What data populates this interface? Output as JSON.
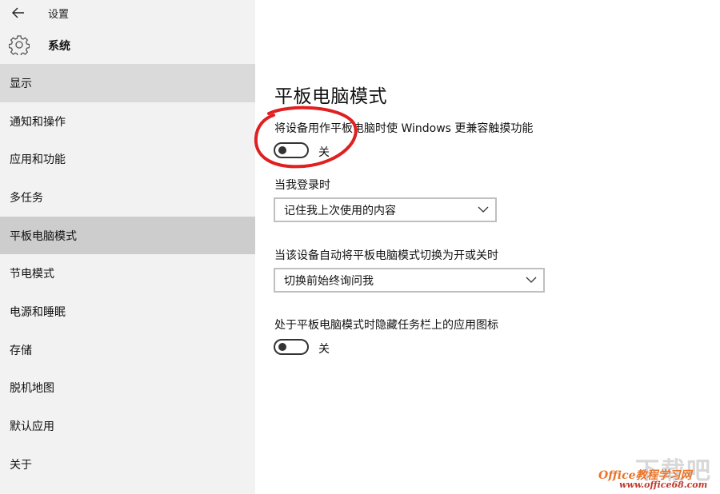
{
  "window": {
    "title": "设置"
  },
  "header": {
    "section": "系统"
  },
  "sidebar": {
    "items": [
      {
        "label": "显示"
      },
      {
        "label": "通知和操作"
      },
      {
        "label": "应用和功能"
      },
      {
        "label": "多任务"
      },
      {
        "label": "平板电脑模式"
      },
      {
        "label": "节电模式"
      },
      {
        "label": "电源和睡眠"
      },
      {
        "label": "存储"
      },
      {
        "label": "脱机地图"
      },
      {
        "label": "默认应用"
      },
      {
        "label": "关于"
      }
    ],
    "selected": "平板电脑模式"
  },
  "main": {
    "title": "平板电脑模式",
    "touch_setting": {
      "label": "将设备用作平板电脑时使 Windows 更兼容触摸功能",
      "state": "关",
      "on": false
    },
    "signin": {
      "label": "当我登录时",
      "value": "记住我上次使用的内容"
    },
    "auto_switch": {
      "label": "当该设备自动将平板电脑模式切换为开或关时",
      "value": "切换前始终询问我"
    },
    "hide_icons": {
      "label": "处于平板电脑模式时隐藏任务栏上的应用图标",
      "state": "关",
      "on": false
    }
  },
  "icons": {
    "back": "back-arrow-icon",
    "gear": "gear-icon",
    "chevron": "chevron-down-icon"
  },
  "colors": {
    "sidebar_bg": "#f2f2f2",
    "selected_bg": "#cdcdcd",
    "annotation_circle": "#e02020"
  },
  "watermark": {
    "big": "下载吧",
    "brand": "Office教程学习网",
    "url": "www.office68.com"
  }
}
